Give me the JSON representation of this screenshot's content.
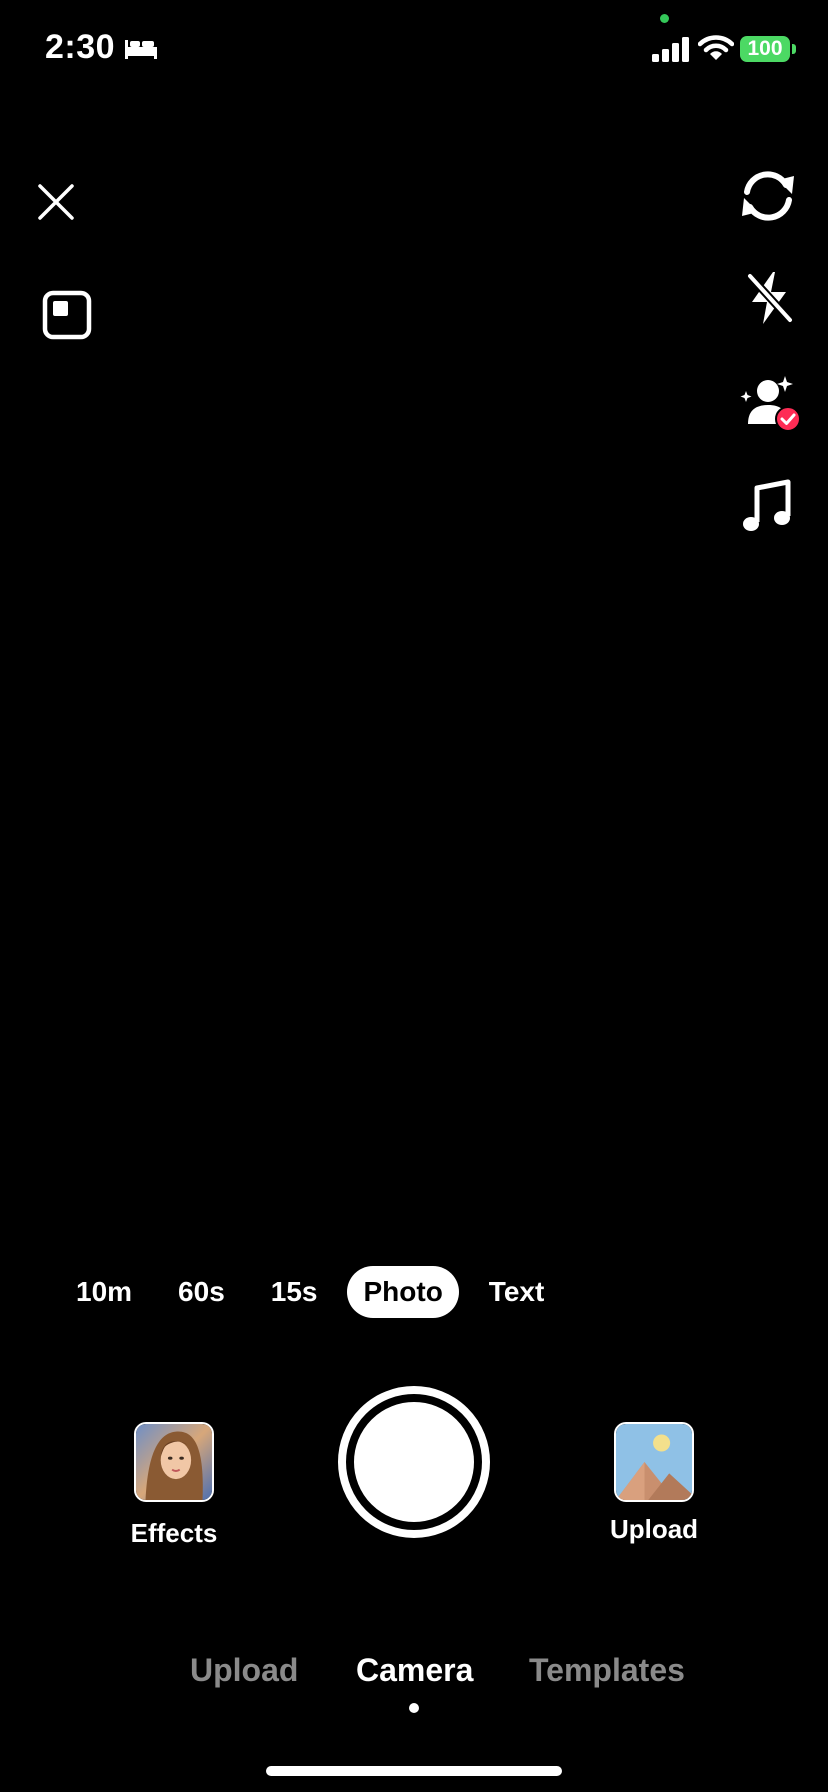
{
  "status_bar": {
    "time": "2:30",
    "battery": "100",
    "battery_color": "#4cd964",
    "privacy_dot_color": "#34c759",
    "icons": [
      "bed-icon",
      "signal-icon",
      "wifi-icon",
      "battery-icon"
    ]
  },
  "top_controls": {
    "left": [
      "close-icon",
      "aspect-ratio-icon"
    ],
    "right": [
      "flip-camera-icon",
      "flash-off-icon",
      "beauty-filter-icon",
      "music-icon"
    ]
  },
  "modes": {
    "items": [
      "10m",
      "60s",
      "15s",
      "Photo",
      "Text"
    ],
    "selected": "Photo"
  },
  "capture": {
    "effects_label": "Effects",
    "upload_label": "Upload"
  },
  "bottom_tabs": {
    "items": [
      "Upload",
      "Camera",
      "Templates"
    ],
    "selected": "Camera"
  }
}
